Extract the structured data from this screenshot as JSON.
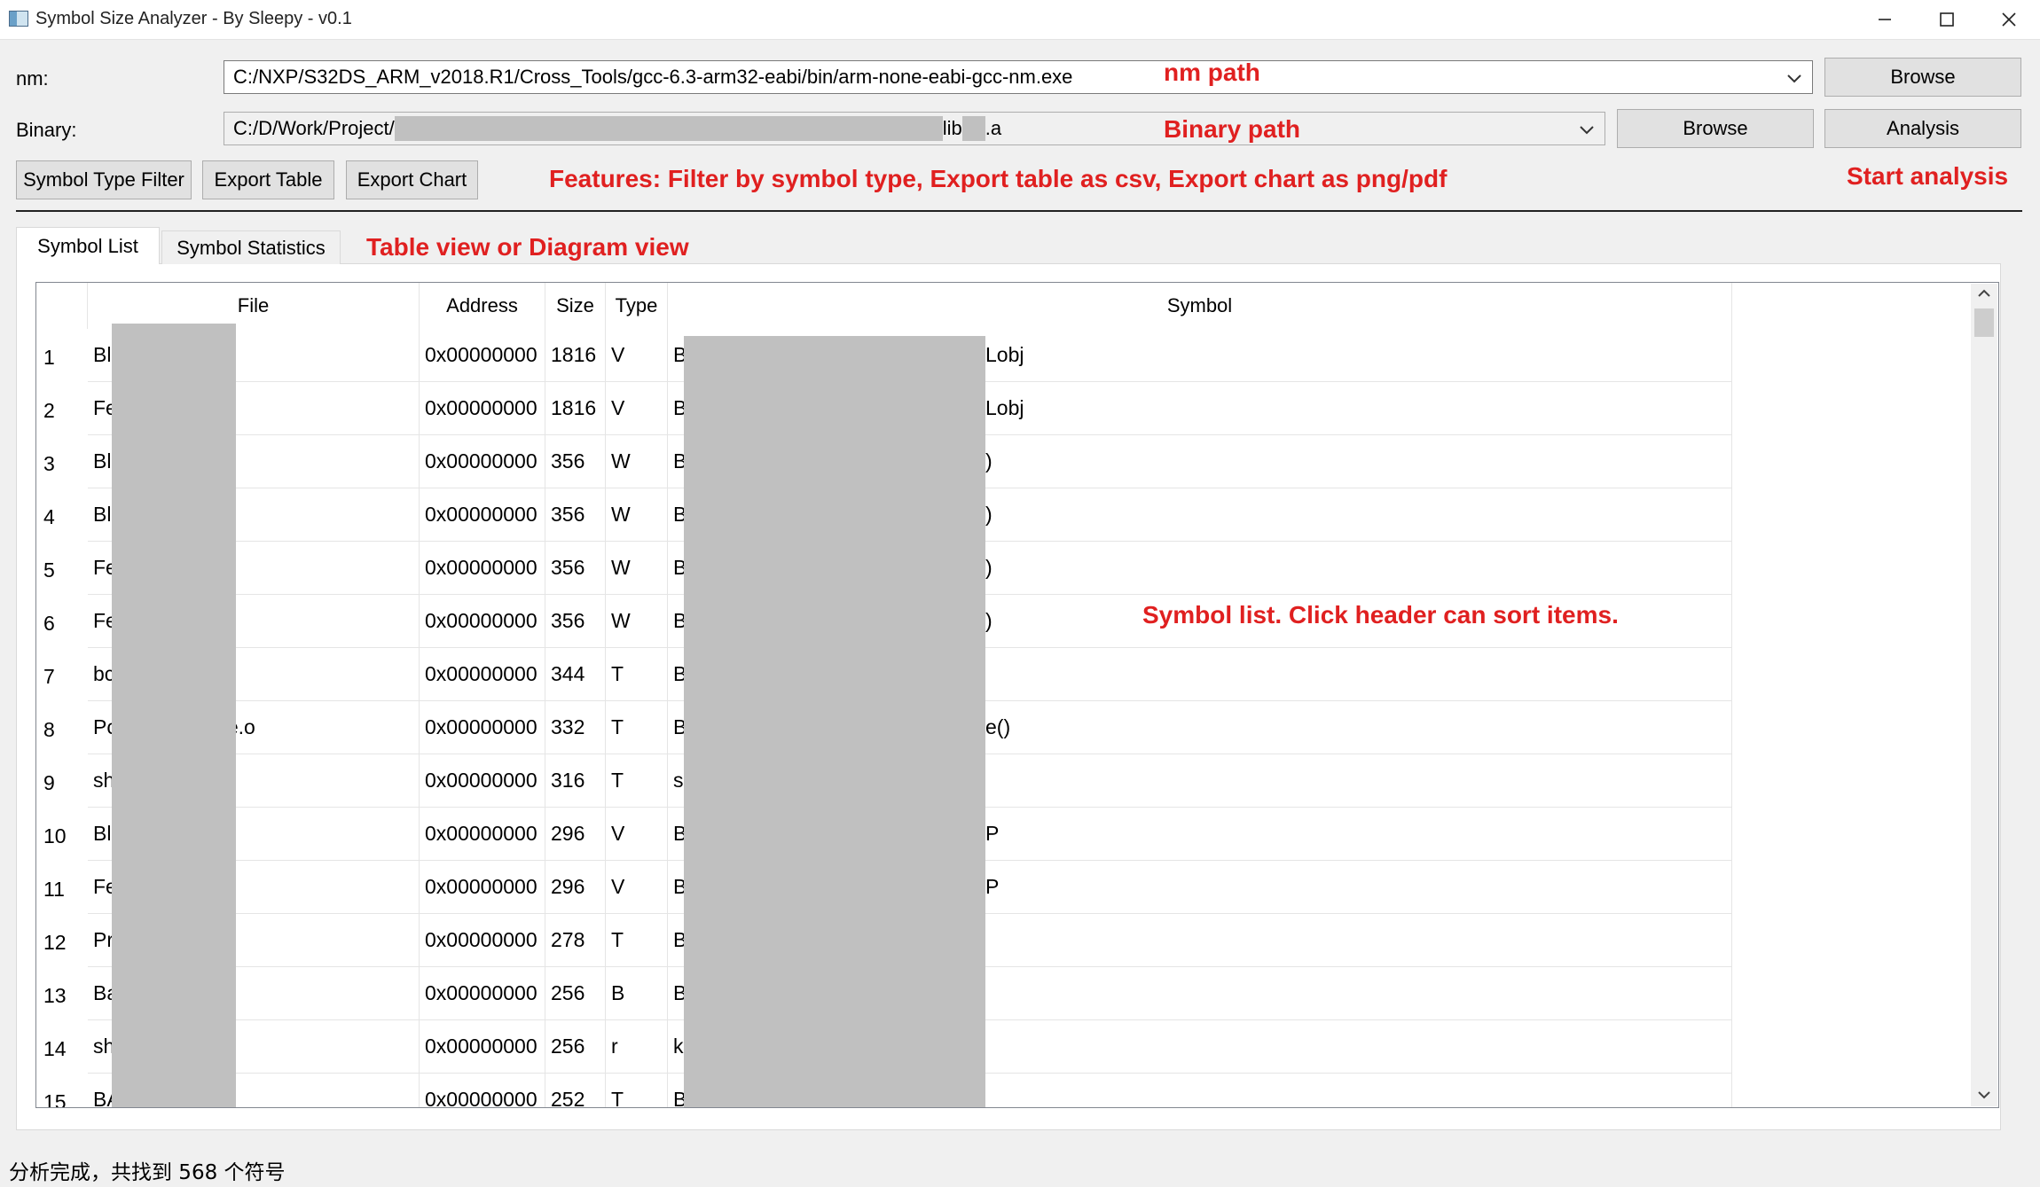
{
  "window": {
    "title": "Symbol Size Analyzer - By Sleepy - v0.1"
  },
  "nm": {
    "label": "nm:",
    "path": "C:/NXP/S32DS_ARM_v2018.R1/Cross_Tools/gcc-6.3-arm32-eabi/bin/arm-none-eabi-gcc-nm.exe",
    "browse_label": "Browse"
  },
  "binary": {
    "label": "Binary:",
    "path_prefix": "C:/D/Work/Project/",
    "path_mid": "lib",
    "path_suffix": ".a",
    "browse_label": "Browse",
    "analysis_label": "Analysis"
  },
  "toolbar": {
    "filter_label": "Symbol Type Filter",
    "export_table_label": "Export Table",
    "export_chart_label": "Export Chart"
  },
  "annotations": {
    "nm_path": "nm path",
    "binary_path": "Binary path",
    "features": "Features: Filter by symbol type, Export table as csv, Export chart as png/pdf",
    "start_analysis": "Start analysis",
    "views": "Table view or Diagram view",
    "symbol_list": "Symbol list. Click header can sort items."
  },
  "tabs": {
    "symbol_list": "Symbol List",
    "symbol_statistics": "Symbol Statistics"
  },
  "table": {
    "headers": {
      "file": "File",
      "address": "Address",
      "size": "Size",
      "type": "Type",
      "symbol": "Symbol"
    },
    "rows": [
      {
        "n": "1",
        "file_a": "Bl",
        "file_b": "",
        "address": "0x00000000",
        "size": "1816",
        "type": "V",
        "sym_a": "B",
        "sym_b": "Lobj"
      },
      {
        "n": "2",
        "file_a": "Fe",
        "file_b": "",
        "address": "0x00000000",
        "size": "1816",
        "type": "V",
        "sym_a": "B",
        "sym_b": "Lobj"
      },
      {
        "n": "3",
        "file_a": "Bl",
        "file_b": "",
        "address": "0x00000000",
        "size": "356",
        "type": "W",
        "sym_a": "B",
        "sym_b": ")"
      },
      {
        "n": "4",
        "file_a": "Bl",
        "file_b": "",
        "address": "0x00000000",
        "size": "356",
        "type": "W",
        "sym_a": "B",
        "sym_b": ")"
      },
      {
        "n": "5",
        "file_a": "Fe",
        "file_b": "",
        "address": "0x00000000",
        "size": "356",
        "type": "W",
        "sym_a": "B",
        "sym_b": ")"
      },
      {
        "n": "6",
        "file_a": "Fe",
        "file_b": "",
        "address": "0x00000000",
        "size": "356",
        "type": "W",
        "sym_a": "B",
        "sym_b": ")"
      },
      {
        "n": "7",
        "file_a": "bc",
        "file_b": "",
        "address": "0x00000000",
        "size": "344",
        "type": "T",
        "sym_a": "B",
        "sym_b": ""
      },
      {
        "n": "8",
        "file_a": "Pc",
        "file_b": "ture.o",
        "address": "0x00000000",
        "size": "332",
        "type": "T",
        "sym_a": "B",
        "sym_b": "e()"
      },
      {
        "n": "9",
        "file_a": "sh",
        "file_b": "",
        "address": "0x00000000",
        "size": "316",
        "type": "T",
        "sym_a": "sl",
        "sym_b": ""
      },
      {
        "n": "10",
        "file_a": "Bl",
        "file_b": "",
        "address": "0x00000000",
        "size": "296",
        "type": "V",
        "sym_a": "B",
        "sym_b": "P"
      },
      {
        "n": "11",
        "file_a": "Fe",
        "file_b": "",
        "address": "0x00000000",
        "size": "296",
        "type": "V",
        "sym_a": "B",
        "sym_b": "P"
      },
      {
        "n": "12",
        "file_a": "Pr",
        "file_b": ".o",
        "address": "0x00000000",
        "size": "278",
        "type": "T",
        "sym_a": "B",
        "sym_b": ""
      },
      {
        "n": "13",
        "file_a": "Ba",
        "file_b": "",
        "address": "0x00000000",
        "size": "256",
        "type": "B",
        "sym_a": "B",
        "sym_b": ""
      },
      {
        "n": "14",
        "file_a": "sh",
        "file_b": "",
        "address": "0x00000000",
        "size": "256",
        "type": "r",
        "sym_a": "k",
        "sym_b": ""
      },
      {
        "n": "15",
        "file_a": "BA",
        "file_b": "",
        "address": "0x00000000",
        "size": "252",
        "type": "T",
        "sym_a": "B",
        "sym_b": ""
      }
    ]
  },
  "status": {
    "text": "分析完成，共找到 568 个符号"
  },
  "icons": {
    "app": "app-icon",
    "minimize": "minimize-icon",
    "maximize": "maximize-icon",
    "close": "close-icon",
    "dropdown": "chevron-down-icon"
  },
  "colors": {
    "annotation": "#e02020",
    "redaction": "#c0c0c0"
  }
}
